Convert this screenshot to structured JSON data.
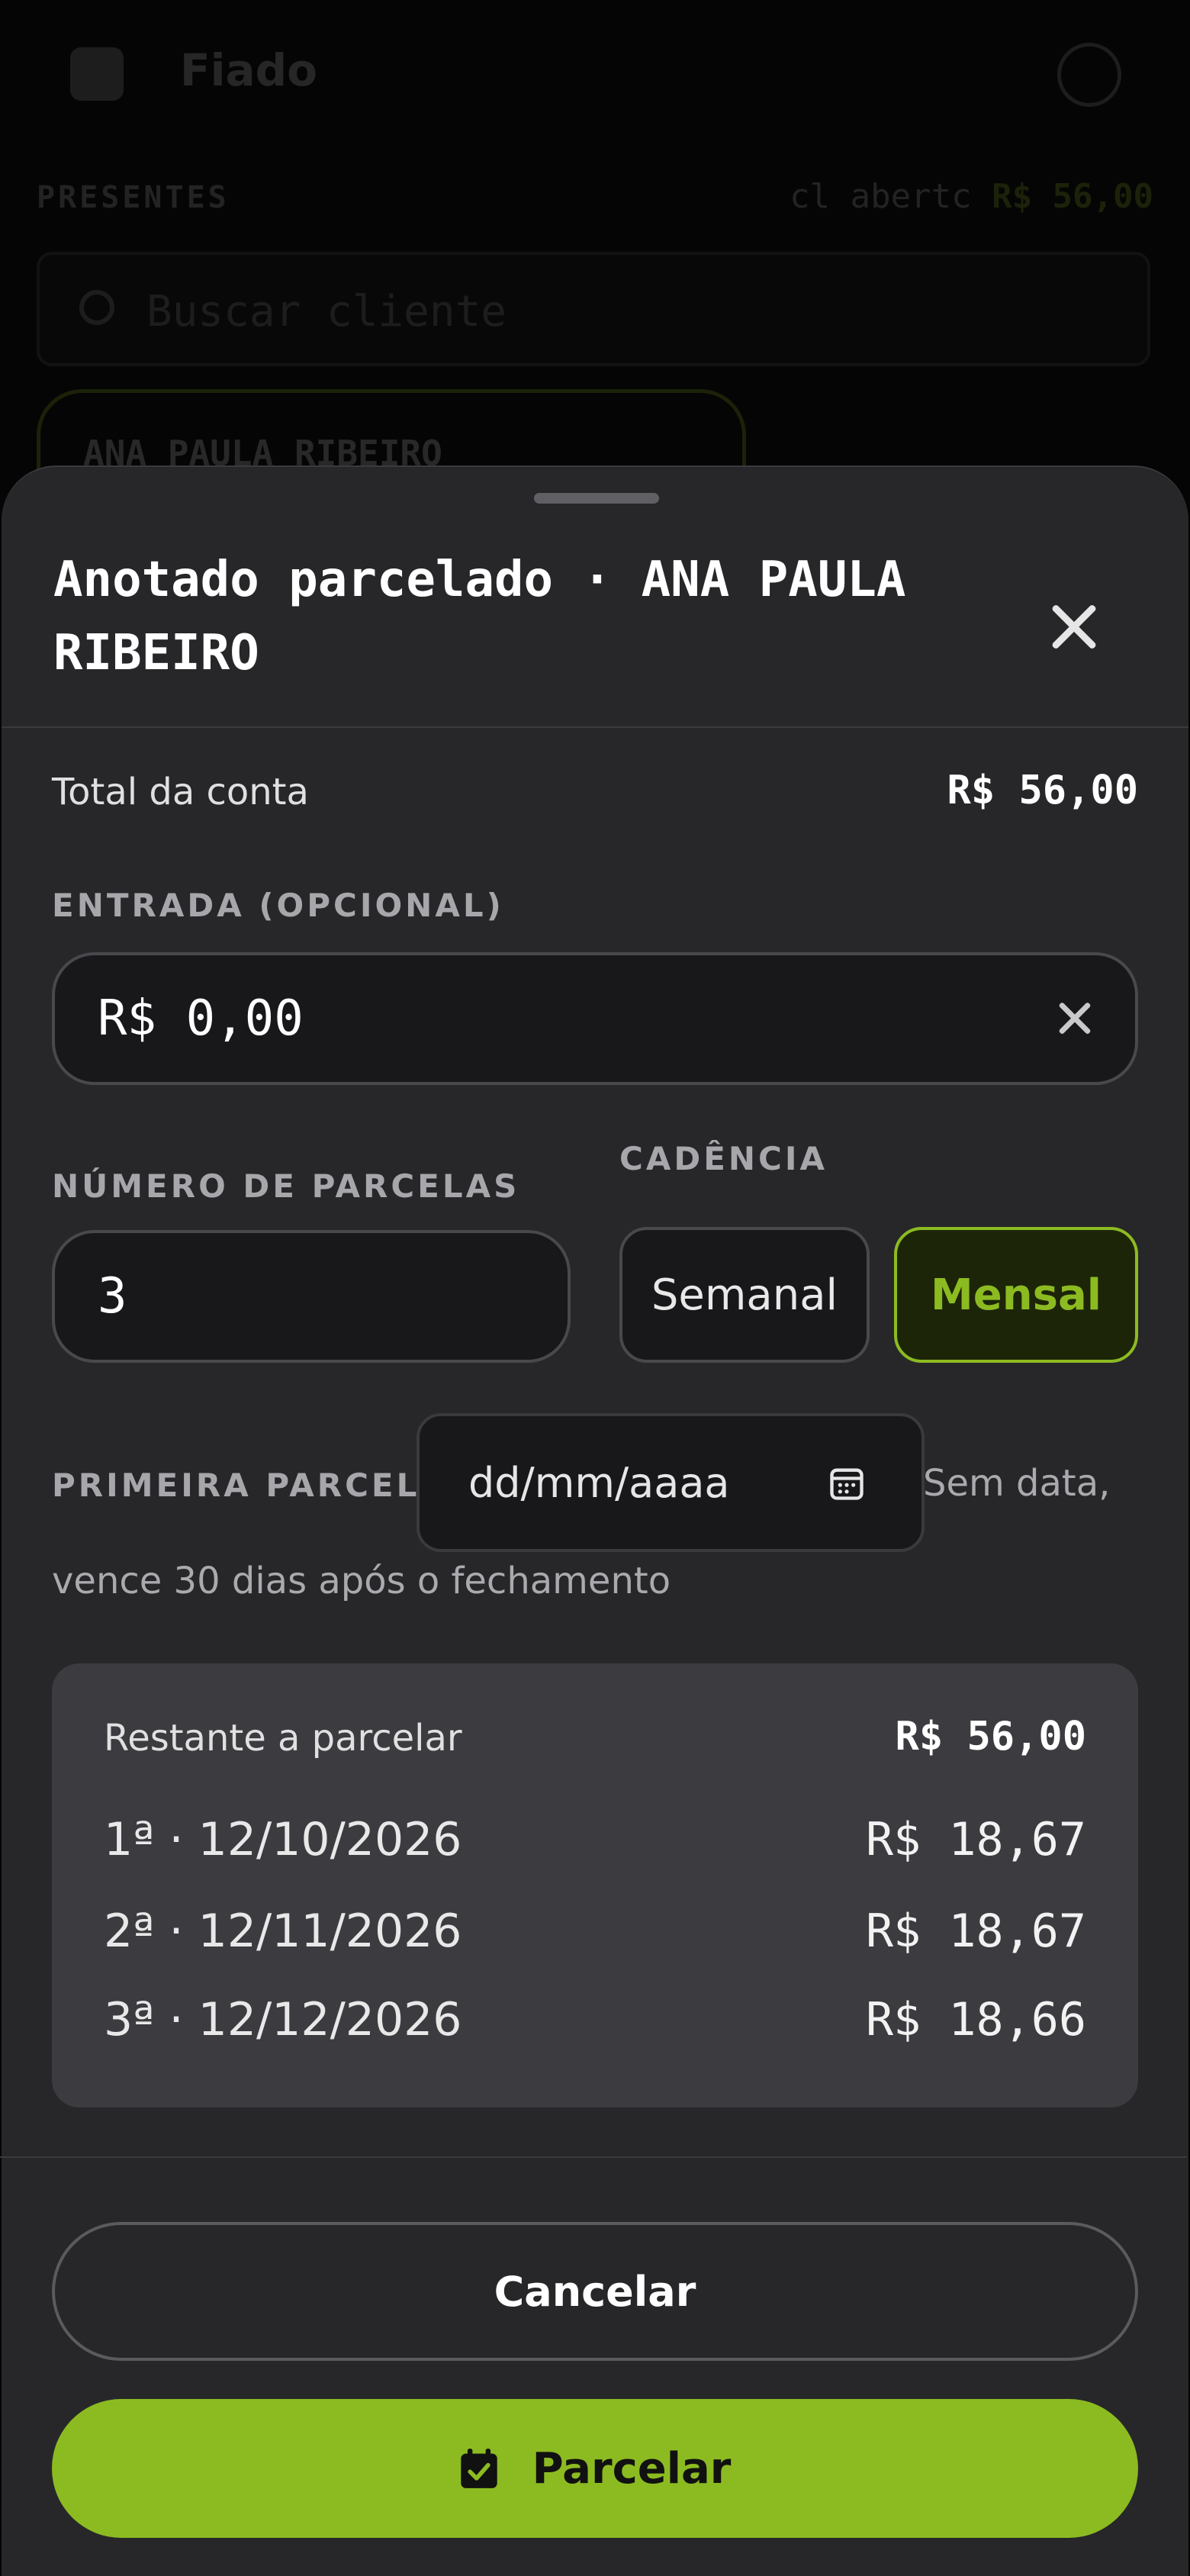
{
  "background": {
    "app_title": "Fiado",
    "section_label": "PRESENTES",
    "count_prefix": "cl abertc",
    "count_value": "R$ 56,00",
    "search_placeholder": "Buscar cliente",
    "card_name": "ANA PAULA RIBEIRO"
  },
  "sheet": {
    "title": "Anotado parcelado · ANA PAULA RIBEIRO",
    "total_label": "Total da conta",
    "total_value": "R$ 56,00",
    "entrada_label": "ENTRADA (OPCIONAL)",
    "entrada_value": "R$ 0,00",
    "parcelas_label": "NÚMERO DE PARCELAS",
    "parcelas_value": "3",
    "cadencia_label": "CADÊNCIA",
    "cadencia_options": [
      "Semanal",
      "Mensal"
    ],
    "cadencia_selected": "Mensal",
    "primeira_label": "PRIMEIRA PARCELA",
    "date_placeholder": "dd/mm/aaaa",
    "hint_a": "Sem data,",
    "hint_b": "vence 30 dias após o fechamento",
    "summary": {
      "label": "Restante a parcelar",
      "total": "R$ 56,00",
      "installments": [
        {
          "date": "1ª · 12/10/2026",
          "amount": "R$ 18,67"
        },
        {
          "date": "2ª · 12/11/2026",
          "amount": "R$ 18,67"
        },
        {
          "date": "3ª · 12/12/2026",
          "amount": "R$ 18,66"
        }
      ]
    },
    "cancel_label": "Cancelar",
    "submit_label": "Parcelar"
  },
  "colors": {
    "accent": "#8cbb21",
    "sheet_bg": "#27272a",
    "input_bg": "#18181b"
  },
  "icons": [
    "menu-icon",
    "avatar-icon",
    "search-icon",
    "close-icon",
    "clear-icon",
    "calendar-icon",
    "calendar-check-icon"
  ]
}
